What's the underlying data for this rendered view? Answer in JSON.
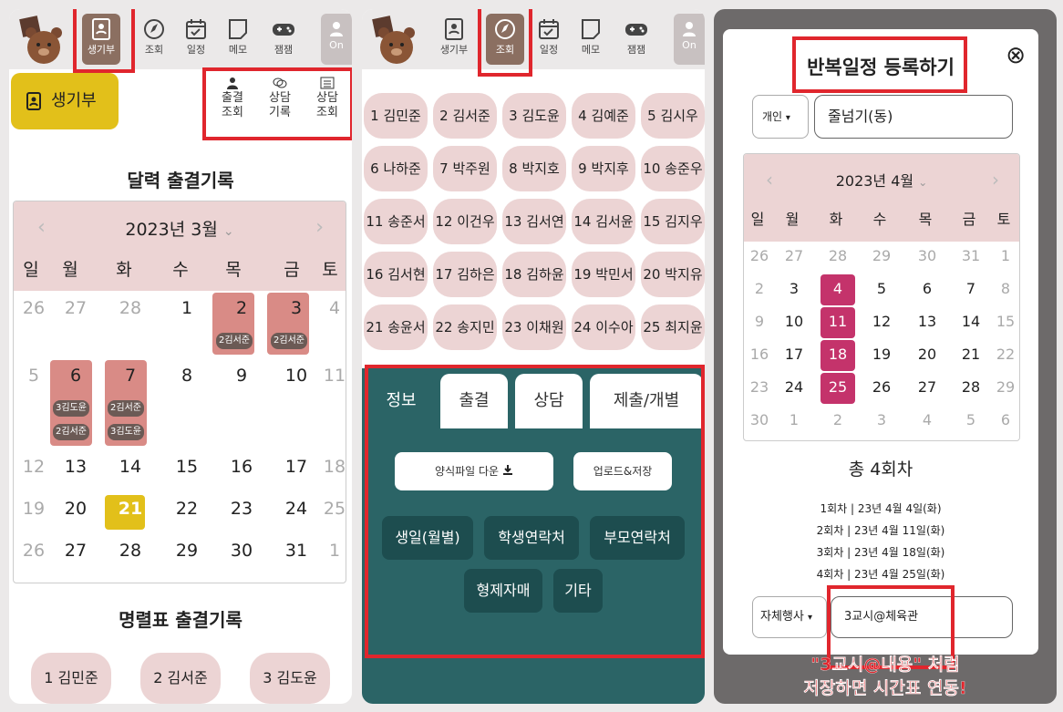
{
  "nav": {
    "record": "생기부",
    "lookup": "조회",
    "schedule": "일정",
    "memo": "메모",
    "play": "잼잼",
    "on": "On"
  },
  "p1": {
    "record_btn": "생기부",
    "sub": [
      {
        "a": "출결",
        "b": "조회"
      },
      {
        "a": "상담",
        "b": "기록"
      },
      {
        "a": "상담",
        "b": "조회"
      }
    ],
    "cal_title": "달력 출결기록",
    "month": "2023년  3월",
    "weekdays": [
      "일",
      "월",
      "화",
      "수",
      "목",
      "금",
      "토"
    ],
    "rows": [
      [
        "26",
        "27",
        "28",
        "1",
        "2",
        "3",
        "4"
      ],
      [
        "5",
        "6",
        "7",
        "8",
        "9",
        "10",
        "11"
      ],
      [
        "12",
        "13",
        "14",
        "15",
        "16",
        "17",
        "18"
      ],
      [
        "19",
        "20",
        "21",
        "22",
        "23",
        "24",
        "25"
      ],
      [
        "26",
        "27",
        "28",
        "29",
        "30",
        "31",
        "1"
      ]
    ],
    "chips": {
      "thu2": "2김서준",
      "fri3": "2김서준",
      "mon6a": "3김도윤",
      "mon6b": "2김서준",
      "tue7a": "2김서준",
      "tue7b": "3김도윤"
    },
    "roster_title": "명렬표 출결기록",
    "roster": [
      "1 김민준",
      "2 김서준",
      "3 김도윤"
    ]
  },
  "p2": {
    "students": [
      "1 김민준",
      "2 김서준",
      "3 김도윤",
      "4 김예준",
      "5 김시우",
      "6 나하준",
      "7 박주원",
      "8 박지호",
      "9 박지후",
      "10 송준우",
      "11 송준서",
      "12 이건우",
      "13 김서연",
      "14 김서윤",
      "15 김지우",
      "16 김서현",
      "17 김하은",
      "18 김하윤",
      "19 박민서",
      "20 박지유",
      "21 송윤서",
      "22 송지민",
      "23 이채원",
      "24 이수아",
      "25 최지윤"
    ],
    "tabs": [
      "정보",
      "출결",
      "상담",
      "제출/개별"
    ],
    "download": "양식파일 다운",
    "upload": "업로드&저장",
    "btns": [
      "생일(월별)",
      "학생연락처",
      "부모연락처",
      "형제자매",
      "기타"
    ]
  },
  "p3": {
    "title": "반복일정 등록하기",
    "close": "⊗",
    "type_sel": "개인",
    "name_val": "줄넘기(동)",
    "month": "2023년   4월",
    "weekdays": [
      "일",
      "월",
      "화",
      "수",
      "목",
      "금",
      "토"
    ],
    "rows": [
      [
        "26",
        "27",
        "28",
        "29",
        "30",
        "31",
        "1"
      ],
      [
        "2",
        "3",
        "4",
        "5",
        "6",
        "7",
        "8"
      ],
      [
        "9",
        "10",
        "11",
        "12",
        "13",
        "14",
        "15"
      ],
      [
        "16",
        "17",
        "18",
        "19",
        "20",
        "21",
        "22"
      ],
      [
        "23",
        "24",
        "25",
        "26",
        "27",
        "28",
        "29"
      ],
      [
        "30",
        "1",
        "2",
        "3",
        "4",
        "5",
        "6"
      ]
    ],
    "total": "총 4회차",
    "list": [
      "1회차 | 23년 4월 4일(화)",
      "2회차 | 23년 4월 11일(화)",
      "3회차 | 23년 4월 18일(화)",
      "4회차 | 23년 4월 25일(화)"
    ],
    "event_sel": "자체행사",
    "event_val": "3교시@체육관",
    "caption1": "\"3교시@내용\" 처럼",
    "caption2": "저장하면 시간표 연동!"
  },
  "colors": {
    "accent": "#e0262d",
    "teal": "#2b6466",
    "pink": "#ecd4d4",
    "brown": "#8b6f61",
    "gold": "#e6c300",
    "marker": "#c4336b"
  }
}
